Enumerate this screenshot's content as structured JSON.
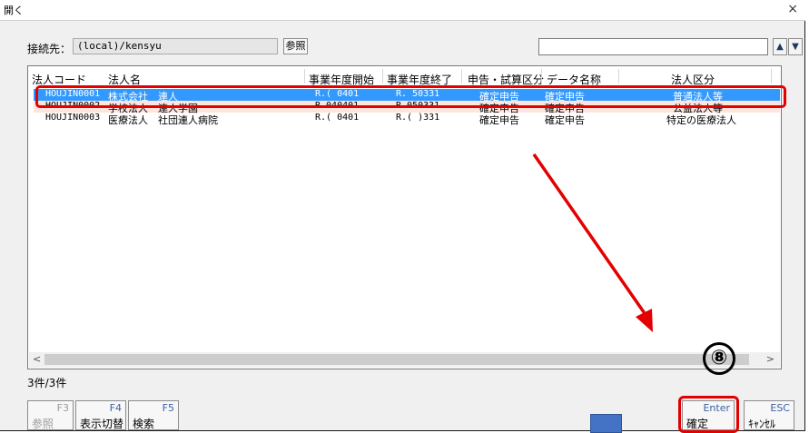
{
  "window": {
    "title": "開く",
    "close_glyph": "×"
  },
  "connection": {
    "label": "接続先：",
    "value": "(local)/kensyu",
    "browse_label": "参照"
  },
  "search": {
    "value": "",
    "up_glyph": "▲",
    "down_glyph": "▼"
  },
  "table": {
    "headers": [
      "法人コード",
      "法人名",
      "事業年度開始",
      "事業年度終了",
      "申告・試算区分",
      "データ名称",
      "法人区分"
    ],
    "rows": [
      {
        "code": "HOUJIN0001",
        "name": "株式会社　連人",
        "start": "R.( 0401",
        "end": "R.  50331",
        "kubun": "確定申告",
        "data_name": "確定申告",
        "houjin_kubun": "普通法人等",
        "state": "selected"
      },
      {
        "code": "HOUJIN0002",
        "name": "学校法人　連人学園",
        "start": "R.040401",
        "end": "R.050331",
        "kubun": "確定申告",
        "data_name": "確定申告",
        "houjin_kubun": "公益法人等",
        "state": "highlight"
      },
      {
        "code": "HOUJIN0003",
        "name": "医療法人　社団連人病院",
        "start": "R.( 0401",
        "end": "R.( )331",
        "kubun": "確定申告",
        "data_name": "確定申告",
        "houjin_kubun": "特定の医療法人",
        "state": "normal"
      }
    ]
  },
  "scroll": {
    "left_glyph": "<",
    "right_glyph": ">"
  },
  "status": {
    "count": "3件/3件"
  },
  "function_keys": [
    {
      "key": "F3",
      "label": "参照",
      "enabled": false
    },
    {
      "key": "F4",
      "label": "表示切替",
      "enabled": true
    },
    {
      "key": "F5",
      "label": "検索",
      "enabled": true
    },
    {
      "key": "Enter",
      "label": "確定",
      "enabled": true
    },
    {
      "key": "ESC",
      "label": "ｷｬﾝｾﾙ",
      "enabled": true
    }
  ],
  "annotation": {
    "step_marker": "⑧",
    "accent_color": "#e30000",
    "selection_color": "#3399ff"
  },
  "icons": {
    "close": "close-icon",
    "up": "arrow-up-icon",
    "down": "arrow-down-icon"
  }
}
